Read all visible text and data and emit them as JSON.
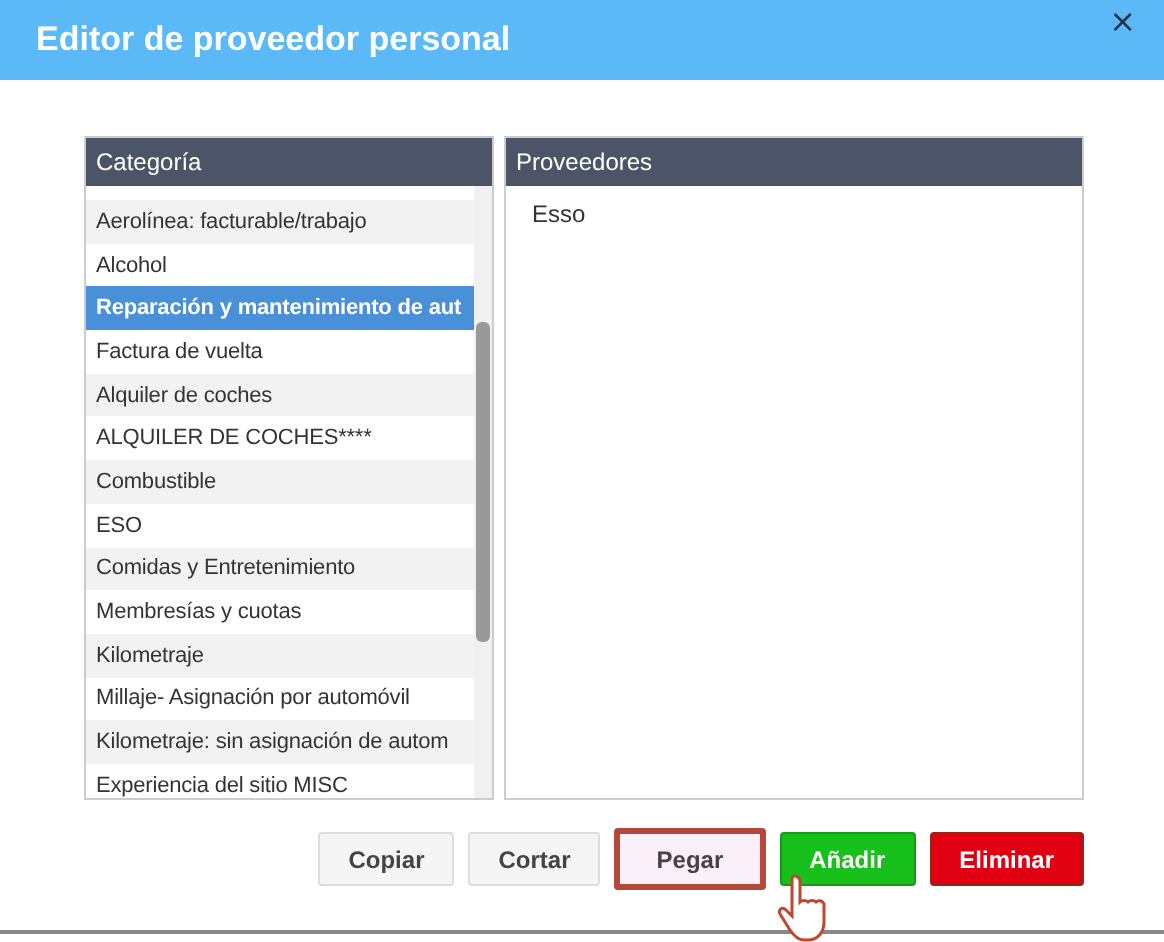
{
  "window": {
    "title": "Editor de proveedor personal",
    "close": "×"
  },
  "categories": {
    "header": "Categoría",
    "items": [
      {
        "label": "Aerolínea: facturable/trabajo",
        "selected": false
      },
      {
        "label": "Alcohol",
        "selected": false
      },
      {
        "label": "Reparación y mantenimiento de aut",
        "selected": true
      },
      {
        "label": "Factura de vuelta",
        "selected": false
      },
      {
        "label": "Alquiler de coches",
        "selected": false
      },
      {
        "label": "ALQUILER DE COCHES****",
        "selected": false
      },
      {
        "label": "Combustible",
        "selected": false
      },
      {
        "label": "ESO",
        "selected": false
      },
      {
        "label": "Comidas y Entretenimiento",
        "selected": false
      },
      {
        "label": "Membresías y cuotas",
        "selected": false
      },
      {
        "label": "Kilometraje",
        "selected": false
      },
      {
        "label": "Millaje- Asignación por automóvil",
        "selected": false
      },
      {
        "label": "Kilometraje: sin asignación de autom",
        "selected": false
      },
      {
        "label": "Experiencia del sitio MISC",
        "selected": false
      }
    ]
  },
  "providers": {
    "header": "Proveedores",
    "items": [
      "Esso"
    ]
  },
  "buttons": [
    {
      "label": "Copiar",
      "kind": "plain",
      "highlighted": false
    },
    {
      "label": "Cortar",
      "kind": "plain",
      "highlighted": false
    },
    {
      "label": "Pegar",
      "kind": "plain",
      "highlighted": true
    },
    {
      "label": "Añadir",
      "kind": "add",
      "highlighted": false
    },
    {
      "label": "Eliminar",
      "kind": "delete",
      "highlighted": false
    }
  ]
}
